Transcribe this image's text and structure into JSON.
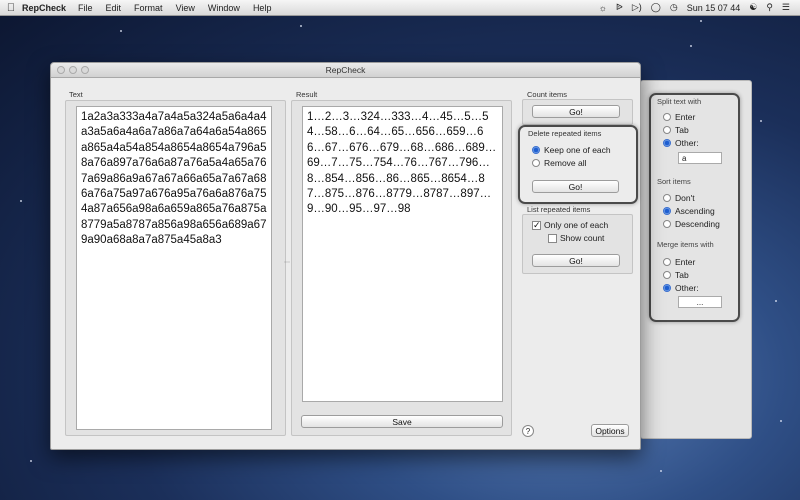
{
  "menubar": {
    "app_name": "RepCheck",
    "menus": [
      "File",
      "Edit",
      "Format",
      "View",
      "Window",
      "Help"
    ],
    "clock": "Sun 15 07 44"
  },
  "window": {
    "title": "RepCheck"
  },
  "text_panel": {
    "label": "Text",
    "content": "1a2a3a333a4a7a4a5a324a5a6a4a4a3a5a6a4a6a7a86a7a64a6a54a865a865a4a54a854a8654a8654a796a58a76a897a76a6a87a76a5a4a65a767a69a86a9a67a67a66a65a7a67a686a76a75a97a676a95a76a6a876a754a87a656a98a6a659a865a76a875a8779a5a8787a856a98a656a689a679a90a68a8a7a875a45a8a3"
  },
  "result_panel": {
    "label": "Result",
    "content": "1…2…3…324…333…4…45…5…54…58…6…64…65…656…659…66…67…676…679…68…686…689…69…7…75…754…76…767…796…8…854…856…86…865…8654…87…875…876…8779…8787…897…9…90…95…97…98",
    "save_label": "Save"
  },
  "count_items": {
    "label": "Count items",
    "go_label": "Go!"
  },
  "delete_repeated": {
    "label": "Delete repeated items",
    "options": [
      "Keep one of each",
      "Remove all"
    ],
    "selected": 0,
    "go_label": "Go!"
  },
  "list_repeated": {
    "label": "List repeated items",
    "only_one_label": "Only one of each",
    "only_one_checked": true,
    "show_count_label": "Show count",
    "show_count_checked": false,
    "go_label": "Go!"
  },
  "help_label": "?",
  "options_label": "Options",
  "options_panel": {
    "split": {
      "label": "Split text with",
      "options": [
        "Enter",
        "Tab",
        "Other:"
      ],
      "selected": 2,
      "other_value": "a"
    },
    "sort": {
      "label": "Sort items",
      "options": [
        "Don't",
        "Ascending",
        "Descending"
      ],
      "selected": 1
    },
    "merge": {
      "label": "Merge items with",
      "options": [
        "Enter",
        "Tab",
        "Other:"
      ],
      "selected": 2,
      "other_value": "..."
    }
  },
  "colors": {
    "highlight_border": "#4a4a4a",
    "radio_selected": "#1f5fd1",
    "desktop": "#2f4f86"
  }
}
